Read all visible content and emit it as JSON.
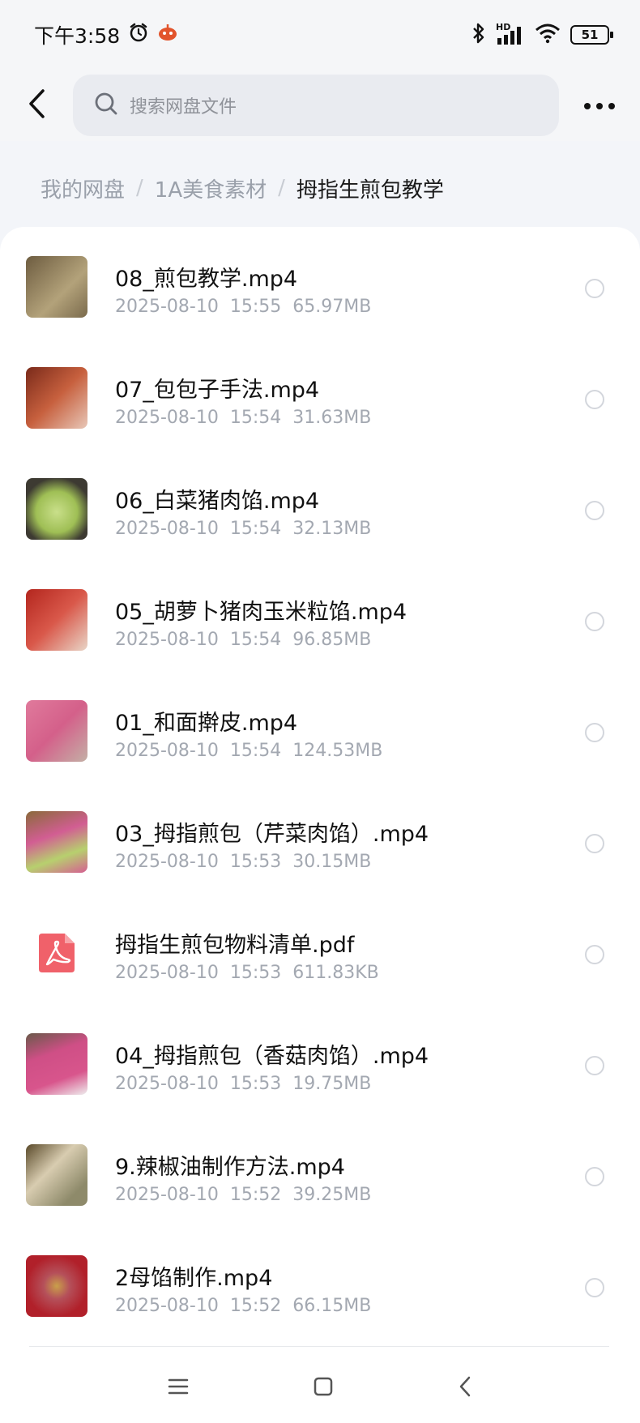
{
  "status_bar": {
    "time": "下午3:58",
    "network_label": "HD",
    "battery": "51"
  },
  "header": {
    "search_placeholder": "搜索网盘文件"
  },
  "breadcrumb": {
    "items": [
      "我的网盘",
      "1A美食素材",
      "拇指生煎包教学"
    ],
    "separator": "/"
  },
  "files": [
    {
      "name": "08_煎包教学.mp4",
      "date": "2025-08-10",
      "time": "15:55",
      "size": "65.97MB",
      "thumb": "food-photo",
      "thumb_color": "#8a7a5c"
    },
    {
      "name": "07_包包子手法.mp4",
      "date": "2025-08-10",
      "time": "15:54",
      "size": "31.63MB",
      "thumb": "food-photo",
      "thumb_color": "#b04a2e"
    },
    {
      "name": "06_白菜猪肉馅.mp4",
      "date": "2025-08-10",
      "time": "15:54",
      "size": "32.13MB",
      "thumb": "food-photo",
      "thumb_color": "#a9c36a"
    },
    {
      "name": "05_胡萝卜猪肉玉米粒馅.mp4",
      "date": "2025-08-10",
      "time": "15:54",
      "size": "96.85MB",
      "thumb": "food-photo",
      "thumb_color": "#c43a2c"
    },
    {
      "name": "01_和面擀皮.mp4",
      "date": "2025-08-10",
      "time": "15:54",
      "size": "124.53MB",
      "thumb": "food-photo",
      "thumb_color": "#d9688c"
    },
    {
      "name": "03_拇指煎包（芹菜肉馅）.mp4",
      "date": "2025-08-10",
      "time": "15:53",
      "size": "30.15MB",
      "thumb": "food-photo",
      "thumb_color": "#d15a8e"
    },
    {
      "name": "拇指生煎包物料清单.pdf",
      "date": "2025-08-10",
      "time": "15:53",
      "size": "611.83KB",
      "thumb": "pdf-icon",
      "thumb_color": "#f0616a"
    },
    {
      "name": "04_拇指煎包（香菇肉馅）.mp4",
      "date": "2025-08-10",
      "time": "15:53",
      "size": "19.75MB",
      "thumb": "food-photo",
      "thumb_color": "#cf4f86"
    },
    {
      "name": "9.辣椒油制作方法.mp4",
      "date": "2025-08-10",
      "time": "15:52",
      "size": "39.25MB",
      "thumb": "food-photo",
      "thumb_color": "#8e8a6a"
    },
    {
      "name": "2母馅制作.mp4",
      "date": "2025-08-10",
      "time": "15:52",
      "size": "66.15MB",
      "thumb": "food-photo",
      "thumb_color": "#b1202a"
    }
  ],
  "colors": {
    "background": "#f3f5f9",
    "card": "#ffffff",
    "text_primary": "#111111",
    "text_secondary": "#a3a8b1",
    "pdf_accent": "#f0616a"
  }
}
